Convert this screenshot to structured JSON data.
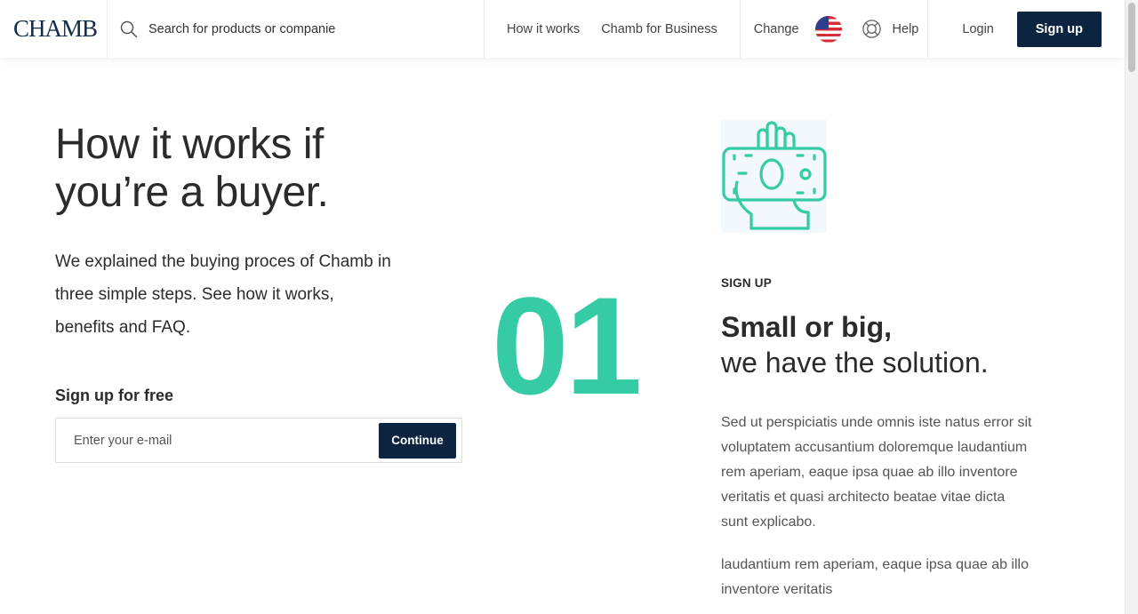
{
  "header": {
    "logo": "CHAMB",
    "search_placeholder": "Search for products or companies",
    "nav": [
      {
        "label": "How it works"
      },
      {
        "label": "Chamb for Business"
      }
    ],
    "change_label": "Change",
    "flag_icon": "us-flag-icon",
    "help_label": "Help",
    "help_icon": "lifebuoy-icon",
    "login_label": "Login",
    "signup_label": "Sign up"
  },
  "hero": {
    "title_line1": "How it works if",
    "title_line2": "you’re a buyer.",
    "description": "We explained the buying proces of Chamb in three simple steps. See how it works, benefits and FAQ.",
    "signup_label": "Sign up for free",
    "email_placeholder": "Enter your e-mail",
    "continue_label": "Continue"
  },
  "step": {
    "number": "01",
    "illustration_icon": "hand-with-money-icon",
    "label": "SIGN UP",
    "heading_strong": "Small or big,",
    "heading_light": "we have the solution.",
    "body": "Sed ut perspiciatis unde omnis iste natus error sit voluptatem accusantium doloremque laudantium rem aperiam, eaque ipsa quae ab illo inventore veritatis et quasi architecto beatae vitae dicta sunt explicabo.",
    "body2": "laudantium rem aperiam, eaque ipsa quae ab illo inventore veritatis"
  },
  "colors": {
    "brand_navy": "#0c2440",
    "accent_green": "#35cca5"
  }
}
